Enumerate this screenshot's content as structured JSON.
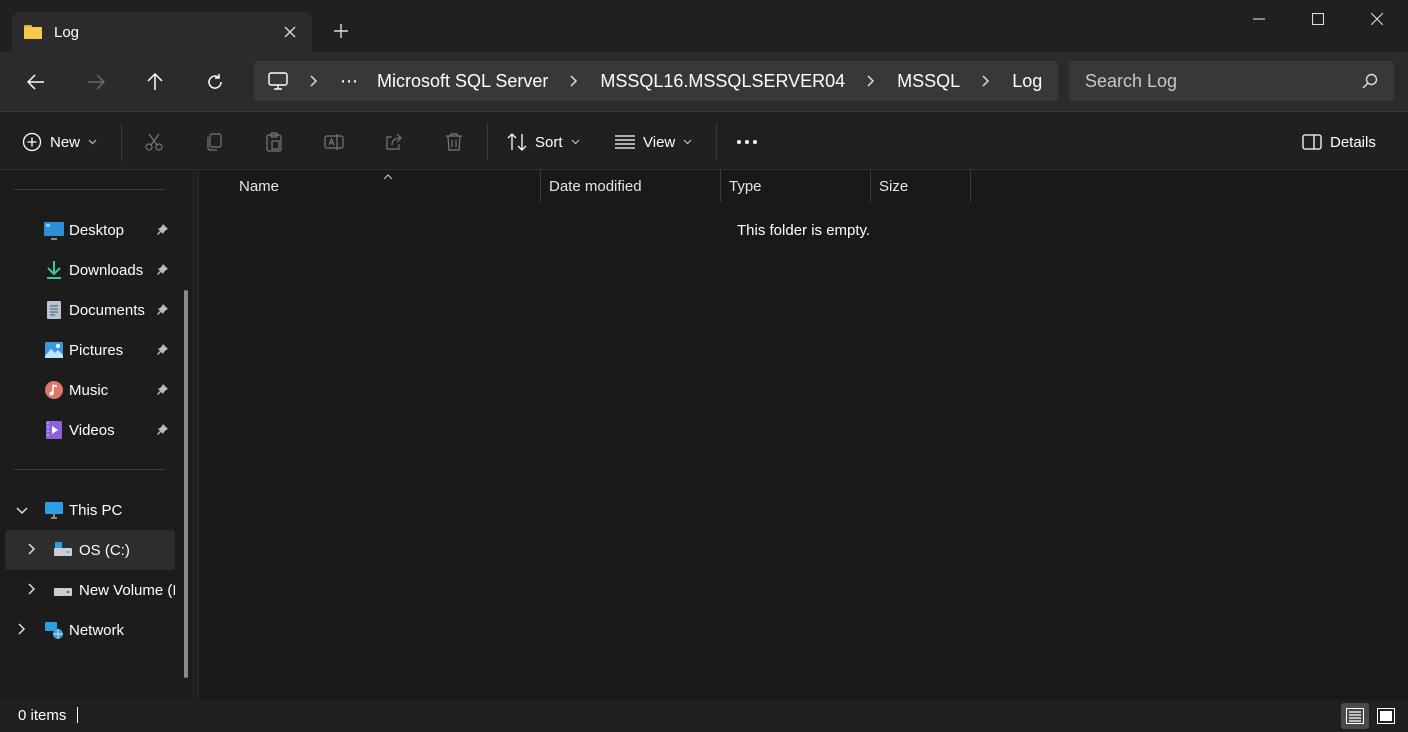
{
  "window": {
    "tab_title": "Log",
    "close_tab_icon": "close-icon",
    "new_tab_icon": "plus-icon"
  },
  "nav": {
    "path": [
      "Microsoft SQL Server",
      "MSSQL16.MSSQLSERVER04",
      "MSSQL",
      "Log"
    ],
    "search_placeholder": "Search Log"
  },
  "toolbar": {
    "new_label": "New",
    "sort_label": "Sort",
    "view_label": "View",
    "details_label": "Details"
  },
  "sidebar": {
    "quick_access": [
      {
        "label": "Desktop",
        "icon": "desktop-icon"
      },
      {
        "label": "Downloads",
        "icon": "downloads-icon"
      },
      {
        "label": "Documents",
        "icon": "documents-icon"
      },
      {
        "label": "Pictures",
        "icon": "pictures-icon"
      },
      {
        "label": "Music",
        "icon": "music-icon"
      },
      {
        "label": "Videos",
        "icon": "videos-icon"
      }
    ],
    "this_pc": "This PC",
    "drives": [
      {
        "label": "OS (C:)",
        "icon": "drive-icon"
      },
      {
        "label": "New Volume (I",
        "icon": "drive-icon"
      }
    ],
    "network": "Network"
  },
  "content": {
    "columns": [
      "Name",
      "Date modified",
      "Type",
      "Size"
    ],
    "empty_message": "This folder is empty."
  },
  "status": {
    "item_count": "0 items"
  },
  "colors": {
    "window_bg": "#202020",
    "toolbar_bg": "#2b2b2b",
    "content_bg": "#191919",
    "accent": "#4cc2ff"
  }
}
